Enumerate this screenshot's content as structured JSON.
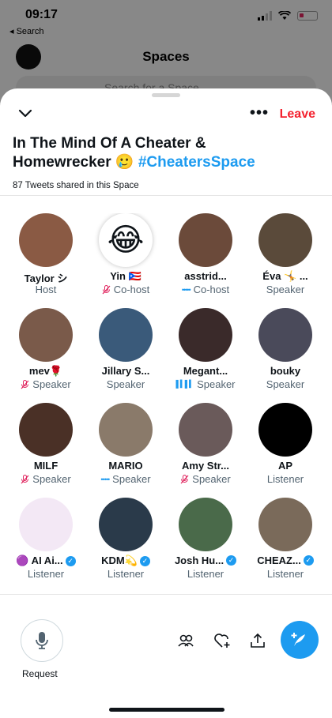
{
  "status_bar": {
    "time": "09:17",
    "back_label": "◂ Search"
  },
  "background": {
    "title": "Spaces",
    "search_placeholder": "Search for a Space"
  },
  "header": {
    "more_label": "•••",
    "leave_label": "Leave",
    "title_text": "In The Mind Of A Cheater & Homewrecker 🥲",
    "hashtag": "#CheatersSpace",
    "tweets_shared": "87 Tweets shared in this Space"
  },
  "participants": [
    {
      "name": "Taylor シ",
      "role": "Host",
      "mic": "none",
      "color": "#8a5a44"
    },
    {
      "name": "Yin 🇵🇷",
      "role": "Co-host",
      "mic": "muted",
      "color": "#ffffff"
    },
    {
      "name": "asstrid...",
      "role": "Co-host",
      "mic": "dots",
      "color": "#6b4a3a"
    },
    {
      "name": "Éva 🤸 ...",
      "role": "Speaker",
      "mic": "none",
      "color": "#5a4a3a"
    },
    {
      "name": "mev🌹",
      "role": "Speaker",
      "mic": "muted",
      "color": "#7a5a4a"
    },
    {
      "name": "Jillary S...",
      "role": "Speaker",
      "mic": "none",
      "color": "#3a5a7a"
    },
    {
      "name": "Megant...",
      "role": "Speaker",
      "mic": "wave",
      "color": "#3a2a2a"
    },
    {
      "name": "bouky",
      "role": "Speaker",
      "mic": "none",
      "color": "#4a4a5a"
    },
    {
      "name": "MILF",
      "role": "Speaker",
      "mic": "muted",
      "color": "#4a3026"
    },
    {
      "name": "MARIO",
      "role": "Speaker",
      "mic": "dots",
      "color": "#8a7a6a"
    },
    {
      "name": "Amy Str...",
      "role": "Speaker",
      "mic": "muted",
      "color": "#6a5a5a"
    },
    {
      "name": "AP",
      "role": "Listener",
      "mic": "none",
      "color": "#000000"
    },
    {
      "name": "🟣 AI Ai...",
      "role": "Listener",
      "mic": "none",
      "verified": true,
      "color": "#f3e8f5"
    },
    {
      "name": "KDM💫",
      "role": "Listener",
      "mic": "none",
      "verified": true,
      "color": "#2a3a4a"
    },
    {
      "name": "Josh Hu...",
      "role": "Listener",
      "mic": "none",
      "verified": true,
      "color": "#4a6a4a"
    },
    {
      "name": "CHEAZ...",
      "role": "Listener",
      "mic": "none",
      "verified": true,
      "color": "#7a6a5a"
    }
  ],
  "bottom_bar": {
    "request_label": "Request"
  },
  "colors": {
    "accent": "#1d9bf0",
    "leave": "#f4212e",
    "muted": "#e0245e"
  }
}
